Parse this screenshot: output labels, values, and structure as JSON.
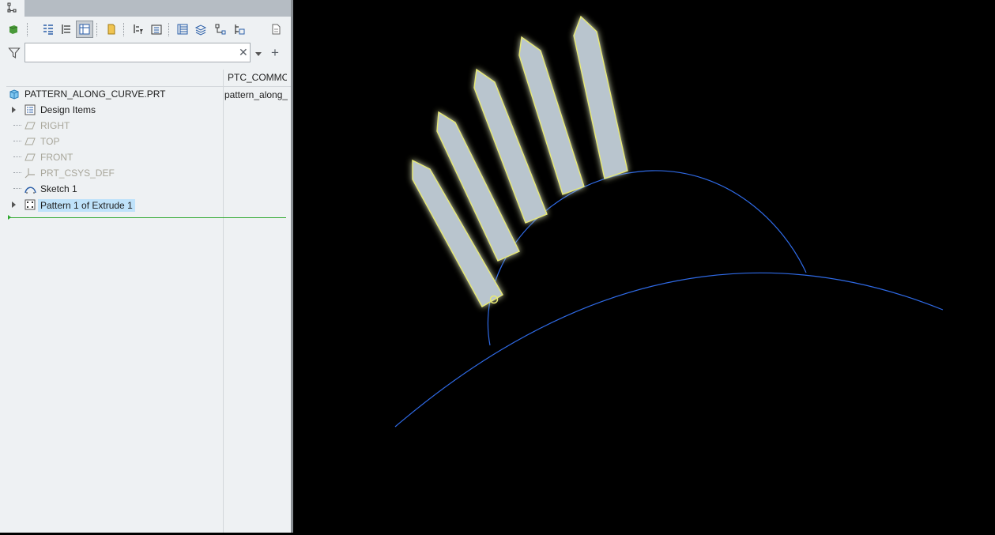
{
  "model_tree": {
    "column_header": "PTC_COMMON_NAME",
    "items": [
      {
        "label": "PATTERN_ALONG_CURVE.PRT",
        "icon": "part-icon",
        "column_value": "pattern_along_curve"
      },
      {
        "label": "Design Items",
        "icon": "design-items-icon",
        "expandable": true
      },
      {
        "label": "RIGHT",
        "icon": "datum-plane-icon"
      },
      {
        "label": "TOP",
        "icon": "datum-plane-icon"
      },
      {
        "label": "FRONT",
        "icon": "datum-plane-icon"
      },
      {
        "label": "PRT_CSYS_DEF",
        "icon": "csys-icon"
      },
      {
        "label": "Sketch 1",
        "icon": "sketch-icon"
      },
      {
        "label": "Pattern 1 of Extrude 1",
        "icon": "pattern-icon",
        "expandable": true,
        "selected": true
      }
    ]
  },
  "search": {
    "value": "",
    "placeholder": ""
  },
  "toolbar": {
    "icons": [
      "show-icon",
      "tree-view-icon",
      "layer-view-icon",
      "tree-filters-icon",
      "folder-browser-icon",
      "feature-filter-icon",
      "settings-icon",
      "table-icon",
      "layers-icon",
      "references-icon",
      "structure-icon",
      "notes-icon"
    ]
  },
  "colors": {
    "panel_bg": "#eef1f3",
    "selection": "#bfe2fa",
    "viewport_bg": "#000000",
    "curve": "#2f6ae6",
    "feature_fill": "#b7c3cc",
    "feature_edge": "#e8ea74",
    "insert_line": "#2ea82e"
  }
}
